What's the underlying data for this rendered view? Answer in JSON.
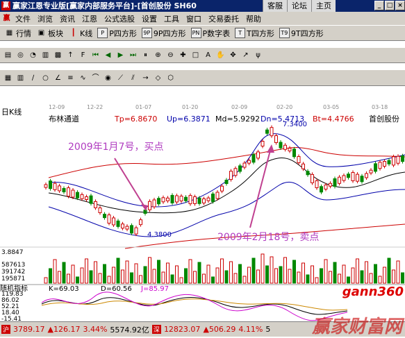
{
  "titlebar": {
    "app_title": "赢家江恩专业版[赢家内部服务平台]-[首创股份 SH60",
    "tabs": [
      "客服",
      "论坛",
      "主页"
    ]
  },
  "menu": [
    "文件",
    "浏览",
    "资讯",
    "江恩",
    "公式选股",
    "设置",
    "工具",
    "窗口",
    "交易委托",
    "帮助"
  ],
  "toolbar1": [
    "行情",
    "板块",
    "K线",
    "P四方形",
    "9P四方形",
    "P数字表",
    "T四方形",
    "9T四方形"
  ],
  "chart": {
    "period": "日K线",
    "indicator_name": "布林通道",
    "tp": "Tp=6.8670",
    "up": "Up=6.3871",
    "md": "Md=5.9292",
    "dn": "Dn=5.4713",
    "bt": "Bt=4.4766",
    "stock_name": "首创股份",
    "date_labels": [
      "12-09",
      "12-22",
      "01-07",
      "01-20",
      "02-09",
      "02-20",
      "03-05",
      "03-18"
    ],
    "high_label": "7.3400",
    "low_label": "4.3800",
    "annotation_buy": "2009年1月7号，买点",
    "annotation_sell": "2009年2月18号，卖点",
    "left_axis_top": "3.8847",
    "volume_axis": [
      "587613",
      "391742",
      "195871"
    ],
    "kdj_title": "随机指标",
    "k": "K=69.03",
    "d": "D=60.56",
    "j": "J=85.97",
    "kdj_axis": [
      "119.83",
      "86.02",
      "52.21",
      "18.40",
      "-15.41"
    ]
  },
  "status": {
    "sh_index": "3789.17",
    "sh_change": "▲126.17",
    "sh_pct": "3.44%",
    "sh_amount": "5574.92亿",
    "sz_index": "12823.07",
    "sz_change": "▲506.29",
    "sz_pct": "4.11%",
    "sz_amount": "5"
  },
  "watermark": "赢家财富网",
  "logo_text": "gann360"
}
